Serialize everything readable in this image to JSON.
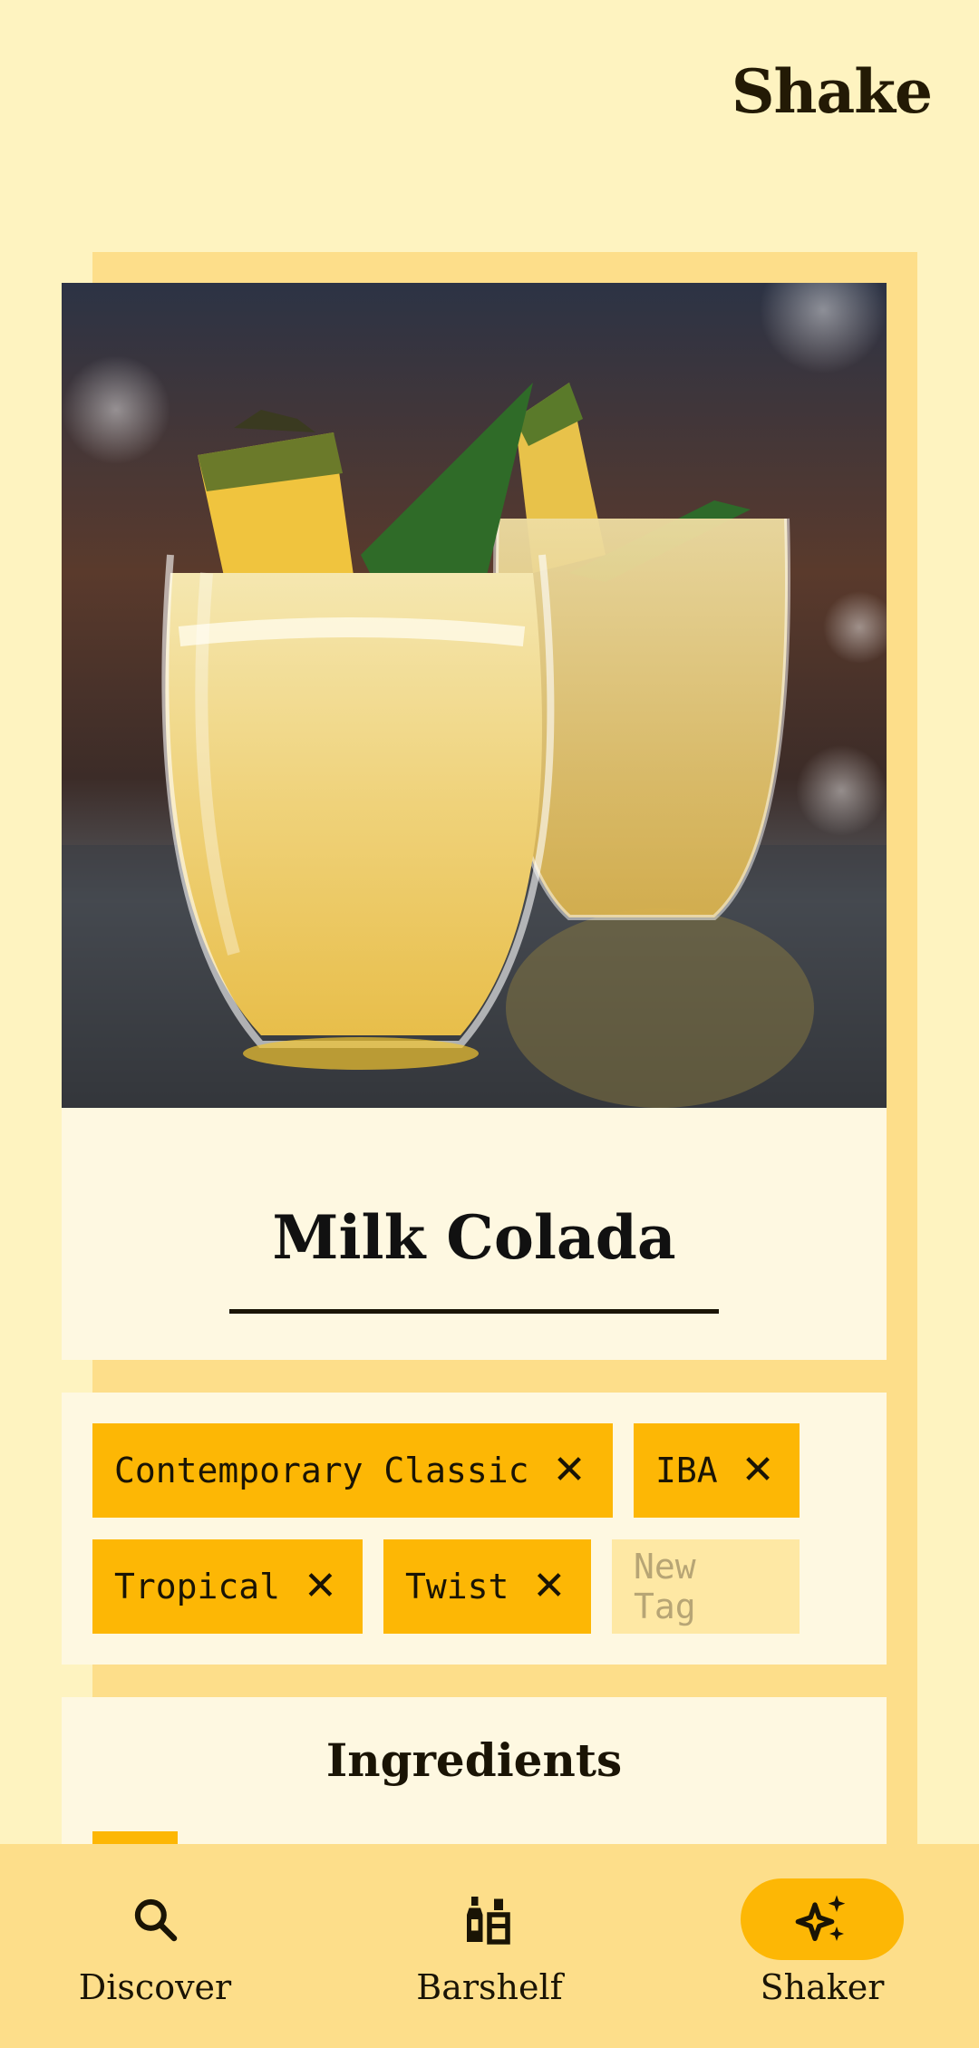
{
  "app": {
    "title": "Shake"
  },
  "drink": {
    "name": "Milk Colada"
  },
  "tags": [
    {
      "label": "Contemporary Classic"
    },
    {
      "label": "IBA"
    },
    {
      "label": "Tropical"
    },
    {
      "label": "Twist"
    }
  ],
  "new_tag": {
    "placeholder": "New Tag"
  },
  "ingredients": {
    "title": "Ingredients"
  },
  "nav": [
    {
      "label": "Discover",
      "icon": "search-icon"
    },
    {
      "label": "Barshelf",
      "icon": "bottle-glass-icon"
    },
    {
      "label": "Shaker",
      "icon": "sparkles-icon",
      "active": true
    }
  ],
  "colors": {
    "background": "#FEF3C0",
    "accent": "#FDB705",
    "panel": "#FEF8E1",
    "shadow": "#FDDE8A",
    "text": "#1A1405"
  }
}
